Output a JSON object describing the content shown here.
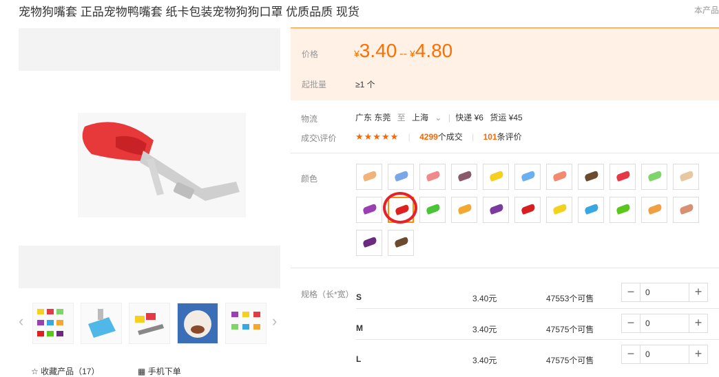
{
  "header": {
    "title": "宠物狗嘴套 正品宠物鸭嘴套 纸卡包装宠物狗狗口罩 优质品质 现货",
    "corner_text": "本产品"
  },
  "price": {
    "label": "价格",
    "currency": "¥",
    "low": "3.40",
    "separator": "--",
    "high": "4.80"
  },
  "moq": {
    "label": "起批量",
    "value": "≥1 个"
  },
  "logistics": {
    "label": "物流",
    "from": "广东 东莞",
    "to_word": "至",
    "dest": "上海",
    "express": "快递 ¥6",
    "freight": "货运 ¥45"
  },
  "deals": {
    "label": "成交\\评价",
    "stars": "★★★★★",
    "sold_count": "4299",
    "sold_suffix": "个成交",
    "review_count": "101",
    "review_suffix": "条评价"
  },
  "color_section": {
    "label": "颜色"
  },
  "swatches": [
    {
      "color": "#f2b37a"
    },
    {
      "color": "#7aa7e8"
    },
    {
      "color": "#f08a8a"
    },
    {
      "color": "#8a5a6a"
    },
    {
      "color": "#f5d020"
    },
    {
      "color": "#6ab0f0"
    },
    {
      "color": "#f28a70"
    },
    {
      "color": "#6b4a2e"
    },
    {
      "color": "#e63946"
    },
    {
      "color": "#7fd46a"
    },
    {
      "color": "#e8c8a0"
    },
    {
      "color": "#9b3fb5"
    },
    {
      "color": "#e02020"
    },
    {
      "color": "#4cc43a"
    },
    {
      "color": "#f4a830"
    },
    {
      "color": "#7a3aa0"
    },
    {
      "color": "#d81e1e"
    },
    {
      "color": "#f2d21a"
    },
    {
      "color": "#3aa8e0"
    },
    {
      "color": "#5ac81a"
    },
    {
      "color": "#f0a040"
    },
    {
      "color": "#d89070"
    },
    {
      "color": "#6a2a80"
    },
    {
      "color": "#6b4a2e"
    }
  ],
  "selected_swatch": 12,
  "spec": {
    "label": "规格（长*宽）",
    "rows": [
      {
        "name": "S",
        "price": "3.40元",
        "stock": "47553个可售",
        "qty": "0",
        "minus": "−",
        "plus": "+"
      },
      {
        "name": "M",
        "price": "3.40元",
        "stock": "47575个可售",
        "qty": "0",
        "minus": "−",
        "plus": "+"
      },
      {
        "name": "L",
        "price": "3.40元",
        "stock": "47575个可售",
        "qty": "0",
        "minus": "−",
        "plus": "+"
      }
    ]
  },
  "gallery": {
    "prev": "‹",
    "next": "›"
  },
  "actions": {
    "favorite": "☆ 收藏产品（17）",
    "mobile": "手机下单"
  }
}
